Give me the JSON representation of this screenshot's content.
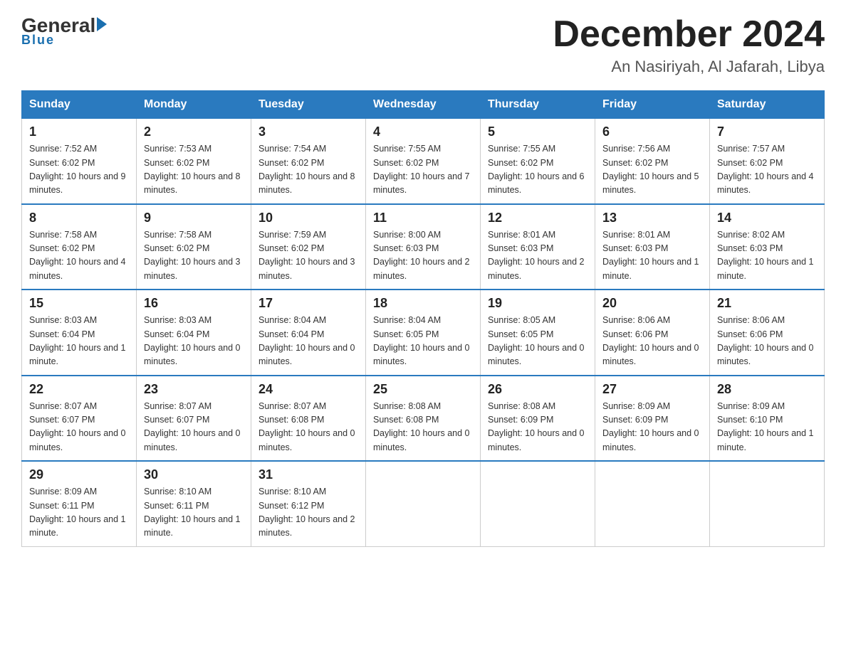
{
  "logo": {
    "general": "General",
    "blue": "Blue",
    "underline": "Blue"
  },
  "title": "December 2024",
  "location": "An Nasiriyah, Al Jafarah, Libya",
  "days_of_week": [
    "Sunday",
    "Monday",
    "Tuesday",
    "Wednesday",
    "Thursday",
    "Friday",
    "Saturday"
  ],
  "weeks": [
    [
      {
        "day": "1",
        "sunrise": "7:52 AM",
        "sunset": "6:02 PM",
        "daylight": "10 hours and 9 minutes."
      },
      {
        "day": "2",
        "sunrise": "7:53 AM",
        "sunset": "6:02 PM",
        "daylight": "10 hours and 8 minutes."
      },
      {
        "day": "3",
        "sunrise": "7:54 AM",
        "sunset": "6:02 PM",
        "daylight": "10 hours and 8 minutes."
      },
      {
        "day": "4",
        "sunrise": "7:55 AM",
        "sunset": "6:02 PM",
        "daylight": "10 hours and 7 minutes."
      },
      {
        "day": "5",
        "sunrise": "7:55 AM",
        "sunset": "6:02 PM",
        "daylight": "10 hours and 6 minutes."
      },
      {
        "day": "6",
        "sunrise": "7:56 AM",
        "sunset": "6:02 PM",
        "daylight": "10 hours and 5 minutes."
      },
      {
        "day": "7",
        "sunrise": "7:57 AM",
        "sunset": "6:02 PM",
        "daylight": "10 hours and 4 minutes."
      }
    ],
    [
      {
        "day": "8",
        "sunrise": "7:58 AM",
        "sunset": "6:02 PM",
        "daylight": "10 hours and 4 minutes."
      },
      {
        "day": "9",
        "sunrise": "7:58 AM",
        "sunset": "6:02 PM",
        "daylight": "10 hours and 3 minutes."
      },
      {
        "day": "10",
        "sunrise": "7:59 AM",
        "sunset": "6:02 PM",
        "daylight": "10 hours and 3 minutes."
      },
      {
        "day": "11",
        "sunrise": "8:00 AM",
        "sunset": "6:03 PM",
        "daylight": "10 hours and 2 minutes."
      },
      {
        "day": "12",
        "sunrise": "8:01 AM",
        "sunset": "6:03 PM",
        "daylight": "10 hours and 2 minutes."
      },
      {
        "day": "13",
        "sunrise": "8:01 AM",
        "sunset": "6:03 PM",
        "daylight": "10 hours and 1 minute."
      },
      {
        "day": "14",
        "sunrise": "8:02 AM",
        "sunset": "6:03 PM",
        "daylight": "10 hours and 1 minute."
      }
    ],
    [
      {
        "day": "15",
        "sunrise": "8:03 AM",
        "sunset": "6:04 PM",
        "daylight": "10 hours and 1 minute."
      },
      {
        "day": "16",
        "sunrise": "8:03 AM",
        "sunset": "6:04 PM",
        "daylight": "10 hours and 0 minutes."
      },
      {
        "day": "17",
        "sunrise": "8:04 AM",
        "sunset": "6:04 PM",
        "daylight": "10 hours and 0 minutes."
      },
      {
        "day": "18",
        "sunrise": "8:04 AM",
        "sunset": "6:05 PM",
        "daylight": "10 hours and 0 minutes."
      },
      {
        "day": "19",
        "sunrise": "8:05 AM",
        "sunset": "6:05 PM",
        "daylight": "10 hours and 0 minutes."
      },
      {
        "day": "20",
        "sunrise": "8:06 AM",
        "sunset": "6:06 PM",
        "daylight": "10 hours and 0 minutes."
      },
      {
        "day": "21",
        "sunrise": "8:06 AM",
        "sunset": "6:06 PM",
        "daylight": "10 hours and 0 minutes."
      }
    ],
    [
      {
        "day": "22",
        "sunrise": "8:07 AM",
        "sunset": "6:07 PM",
        "daylight": "10 hours and 0 minutes."
      },
      {
        "day": "23",
        "sunrise": "8:07 AM",
        "sunset": "6:07 PM",
        "daylight": "10 hours and 0 minutes."
      },
      {
        "day": "24",
        "sunrise": "8:07 AM",
        "sunset": "6:08 PM",
        "daylight": "10 hours and 0 minutes."
      },
      {
        "day": "25",
        "sunrise": "8:08 AM",
        "sunset": "6:08 PM",
        "daylight": "10 hours and 0 minutes."
      },
      {
        "day": "26",
        "sunrise": "8:08 AM",
        "sunset": "6:09 PM",
        "daylight": "10 hours and 0 minutes."
      },
      {
        "day": "27",
        "sunrise": "8:09 AM",
        "sunset": "6:09 PM",
        "daylight": "10 hours and 0 minutes."
      },
      {
        "day": "28",
        "sunrise": "8:09 AM",
        "sunset": "6:10 PM",
        "daylight": "10 hours and 1 minute."
      }
    ],
    [
      {
        "day": "29",
        "sunrise": "8:09 AM",
        "sunset": "6:11 PM",
        "daylight": "10 hours and 1 minute."
      },
      {
        "day": "30",
        "sunrise": "8:10 AM",
        "sunset": "6:11 PM",
        "daylight": "10 hours and 1 minute."
      },
      {
        "day": "31",
        "sunrise": "8:10 AM",
        "sunset": "6:12 PM",
        "daylight": "10 hours and 2 minutes."
      },
      null,
      null,
      null,
      null
    ]
  ]
}
